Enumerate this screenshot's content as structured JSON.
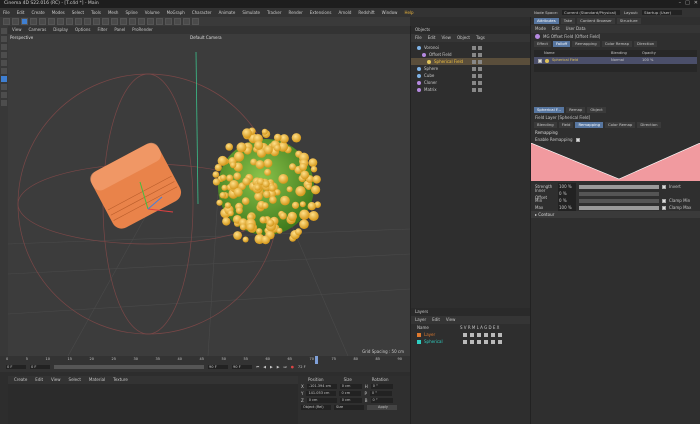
{
  "titlebar": {
    "title": "Cinema 4D S22.016 (RC) - [T.c4d *] - Main"
  },
  "menu": [
    "File",
    "Edit",
    "Create",
    "Modes",
    "Select",
    "Tools",
    "Mesh",
    "Spline",
    "Volume",
    "MoGraph",
    "Character",
    "Animate",
    "Simulate",
    "Tracker",
    "Render",
    "Extensions",
    "Arnold",
    "Redshift",
    "Window",
    "Help"
  ],
  "menu_highlight": "Help",
  "layout": {
    "node_space_label": "Node Space:",
    "node_space_value": "Current (Standard/Physical)",
    "layout_label": "Layout:",
    "layout_value": "Startup (User)"
  },
  "viewport": {
    "menu": [
      "View",
      "Cameras",
      "Display",
      "Options",
      "Filter",
      "Panel",
      "ProRender"
    ],
    "label": "Perspective",
    "camera": "Default Camera",
    "grid_spacing": "Grid Spacing : 50 cm"
  },
  "timeline": {
    "ticks": [
      "0",
      "5",
      "10",
      "15",
      "20",
      "25",
      "30",
      "35",
      "40",
      "45",
      "50",
      "55",
      "60",
      "65",
      "70",
      "75",
      "80",
      "85",
      "90"
    ],
    "start": "0 F",
    "current": "0 F",
    "end": "90 F",
    "end2": "90 F",
    "frame_readout": "72 F"
  },
  "material_menu": [
    "Create",
    "Edit",
    "View",
    "Select",
    "Material",
    "Texture"
  ],
  "coords": {
    "headers": [
      "Position",
      "Size",
      "Rotation"
    ],
    "rows": [
      {
        "axis": "X",
        "pos": "-101.394 cm",
        "size": "0 cm",
        "rot_axis": "H",
        "rot": "0 °"
      },
      {
        "axis": "Y",
        "pos": "141.053 cm",
        "size": "0 cm",
        "rot_axis": "P",
        "rot": "0 °"
      },
      {
        "axis": "Z",
        "pos": "0 cm",
        "size": "0 cm",
        "rot_axis": "B",
        "rot": "0 °"
      }
    ],
    "object_mode": "Object (Rel)",
    "size_mode": "Size",
    "apply": "Apply"
  },
  "objects": {
    "tab": "Objects",
    "menu": [
      "File",
      "Edit",
      "View",
      "Object",
      "Tags"
    ],
    "items": [
      {
        "name": "Voronoi",
        "color": "#7fb3e6",
        "selected": false,
        "indent": 0
      },
      {
        "name": "Offset Field",
        "color": "#b589e0",
        "selected": false,
        "indent": 1
      },
      {
        "name": "Spherical Field",
        "color": "#e0c35a",
        "selected": true,
        "indent": 2
      },
      {
        "name": "Sphere",
        "color": "#7fb3e6",
        "selected": false,
        "indent": 0
      },
      {
        "name": "Cube",
        "color": "#7fb3e6",
        "selected": false,
        "indent": 0
      },
      {
        "name": "Cloner",
        "color": "#b589e0",
        "selected": false,
        "indent": 0
      },
      {
        "name": "Matrix",
        "color": "#b589e0",
        "selected": false,
        "indent": 0
      }
    ]
  },
  "layers": {
    "tab": "Layers",
    "menu": [
      "Layer",
      "Edit",
      "View"
    ],
    "header": "Name",
    "cols": "S V R M L A G D E X",
    "items": [
      {
        "name": "Layer",
        "color": "#e07a2e"
      },
      {
        "name": "Spherical",
        "color": "#2ecfc2"
      }
    ]
  },
  "attributes": {
    "tabs": [
      "Attributes",
      "Take",
      "Content Browser",
      "Structure"
    ],
    "menu": [
      "Mode",
      "Edit",
      "User Data"
    ],
    "object_title": "MG Offset Field [Offset Field]",
    "field_tabs": [
      "Effect",
      "Falloff",
      "Remapping",
      "Color Remap",
      "Direction"
    ],
    "field_tab_active": "Falloff",
    "list_headers": [
      "Name",
      "Blending",
      "Opacity"
    ],
    "list_row": {
      "name": "Spherical Field",
      "blending": "Normal",
      "opacity": "100 %"
    },
    "layer_tabs": [
      "Spherical F...",
      "Remap",
      "Object"
    ],
    "layer_title": "Field Layer [Spherical Field]",
    "layer_sub_tabs": [
      "Blending",
      "Field",
      "Remapping",
      "Color Remap",
      "Direction"
    ],
    "layer_sub_active": "Remapping",
    "section": "Remapping",
    "enable_remapping": "Enable Remapping",
    "strength_label": "Strength",
    "strength_value": "100 %",
    "strength": 1.0,
    "invert_label": "Invert",
    "inner_offset_label": "Inner Offset",
    "inner_offset_value": "0 %",
    "inner_offset": 0,
    "min_label": "Min",
    "min_value": "0 %",
    "min": 0,
    "clamp_min_label": "Clamp Min",
    "max_label": "Max",
    "max_value": "100 %",
    "max": 1.0,
    "clamp_max_label": "Clamp Max",
    "contour_label": "Contour"
  }
}
